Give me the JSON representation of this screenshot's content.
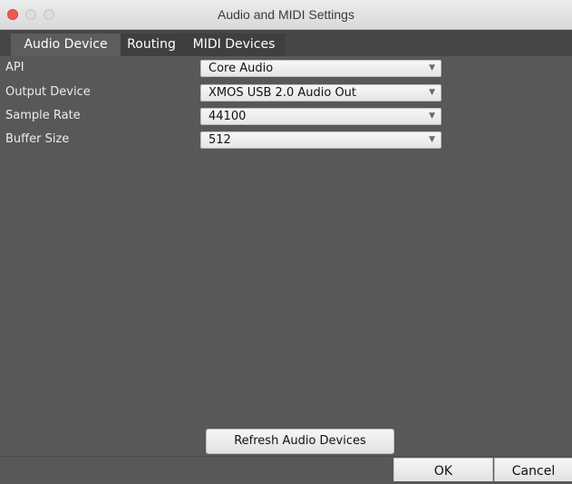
{
  "window": {
    "title": "Audio and MIDI Settings"
  },
  "tabs": [
    {
      "label": "Audio Device",
      "active": true
    },
    {
      "label": "Routing",
      "active": false
    },
    {
      "label": "MIDI Devices",
      "active": false
    }
  ],
  "settings": [
    {
      "label": "API",
      "value": "Core Audio"
    },
    {
      "label": "Output Device",
      "value": "XMOS USB 2.0 Audio Out"
    },
    {
      "label": "Sample Rate",
      "value": "44100"
    },
    {
      "label": "Buffer Size",
      "value": "512"
    }
  ],
  "buttons": {
    "refresh": "Refresh Audio Devices",
    "ok": "OK",
    "cancel": "Cancel"
  },
  "icons": {
    "dropdown": "chevron-down-icon"
  },
  "colors": {
    "background": "#585858",
    "close_button": "#ee5a52"
  }
}
